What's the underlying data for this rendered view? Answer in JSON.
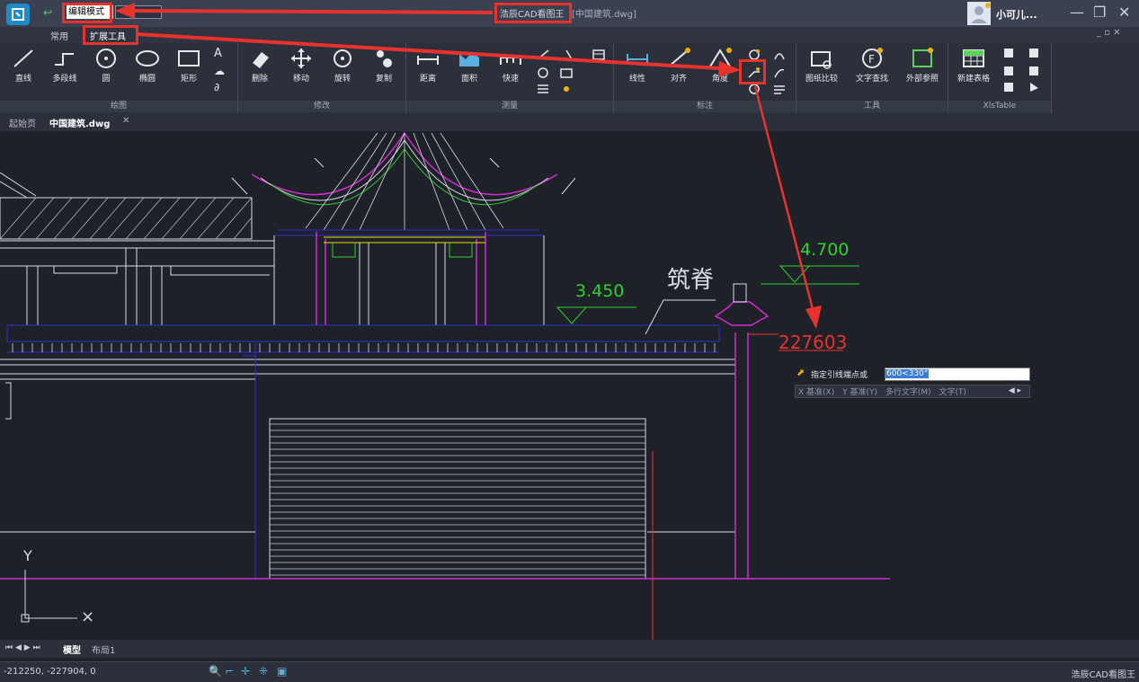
{
  "titlebar": {
    "mode_value": "编辑模式",
    "app_name": "浩辰CAD看图王",
    "file_name": "[中国建筑.dwg]",
    "user_name": "小可儿..."
  },
  "ribbon_tabs": [
    "常用",
    "扩展工具"
  ],
  "ribbon": {
    "draw": {
      "label": "绘图",
      "tools": [
        "直线",
        "多段线",
        "圆",
        "椭圆",
        "矩形"
      ]
    },
    "modify": {
      "label": "修改",
      "tools": [
        "删除",
        "移动",
        "旋转",
        "复制"
      ]
    },
    "measure": {
      "label": "测量",
      "tools": [
        "距离",
        "面积",
        "快速"
      ]
    },
    "annotate": {
      "label": "标注",
      "tools": [
        "线性",
        "对齐",
        "角度"
      ]
    },
    "tools": {
      "label": "工具",
      "tools": [
        "图纸比较",
        "文字查找",
        "外部参照"
      ]
    },
    "xls": {
      "label": "XlsTable",
      "tools": [
        "新建表格"
      ]
    }
  },
  "doc_tabs": [
    "起始页",
    "中国建筑.dwg"
  ],
  "drawing": {
    "elev1": "3.450",
    "elev2": "4.700",
    "text_label": "筑脊",
    "red_value": "227603"
  },
  "command": {
    "prompt": "指定引线端点或",
    "input": "600<330°",
    "options": [
      "X 基准(X)",
      "Y 基准(Y)",
      "多行文字(M)",
      "文字(T)"
    ]
  },
  "layout_tabs": [
    "模型",
    "布局1"
  ],
  "status": {
    "coords": "-212250, -227904, 0",
    "app": "浩辰CAD看图王"
  },
  "colors": {
    "accent_red": "#e8322e",
    "cad_green": "#2fd12f",
    "cad_magenta": "#d22bd2",
    "cad_blue": "#2d2dd8"
  }
}
